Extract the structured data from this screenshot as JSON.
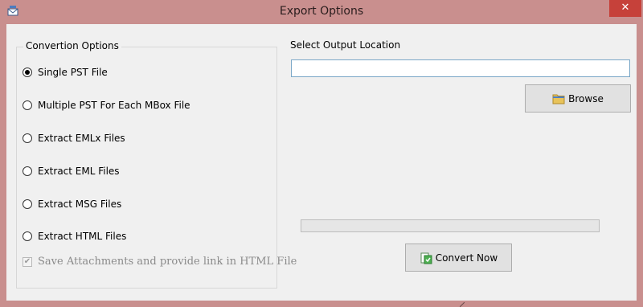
{
  "window": {
    "title": "Export Options",
    "close_label": "✕"
  },
  "conversion": {
    "group_label": "Convertion Options",
    "options": [
      {
        "label": "Single PST File",
        "checked": true
      },
      {
        "label": "Multiple PST For Each MBox File",
        "checked": false
      },
      {
        "label": "Extract EMLx Files",
        "checked": false
      },
      {
        "label": "Extract EML Files",
        "checked": false
      },
      {
        "label": "Extract MSG Files",
        "checked": false
      },
      {
        "label": "Extract HTML Files",
        "checked": false
      }
    ],
    "attachments": {
      "label": "Save Attachments and provide link in HTML File",
      "checked": true,
      "enabled": false
    }
  },
  "output": {
    "label": "Select Output Location",
    "value": ""
  },
  "buttons": {
    "browse_label": "Browse",
    "convert_label": "Convert Now"
  },
  "progress": {
    "value": 0
  },
  "colors": {
    "window_frame": "#c98f8e",
    "close_button": "#c6413a",
    "client_bg": "#f0f0f0",
    "input_border": "#7aa7c7"
  },
  "icons": {
    "app": "envelope-export-icon",
    "browse": "folder-icon",
    "convert": "convert-icon"
  }
}
